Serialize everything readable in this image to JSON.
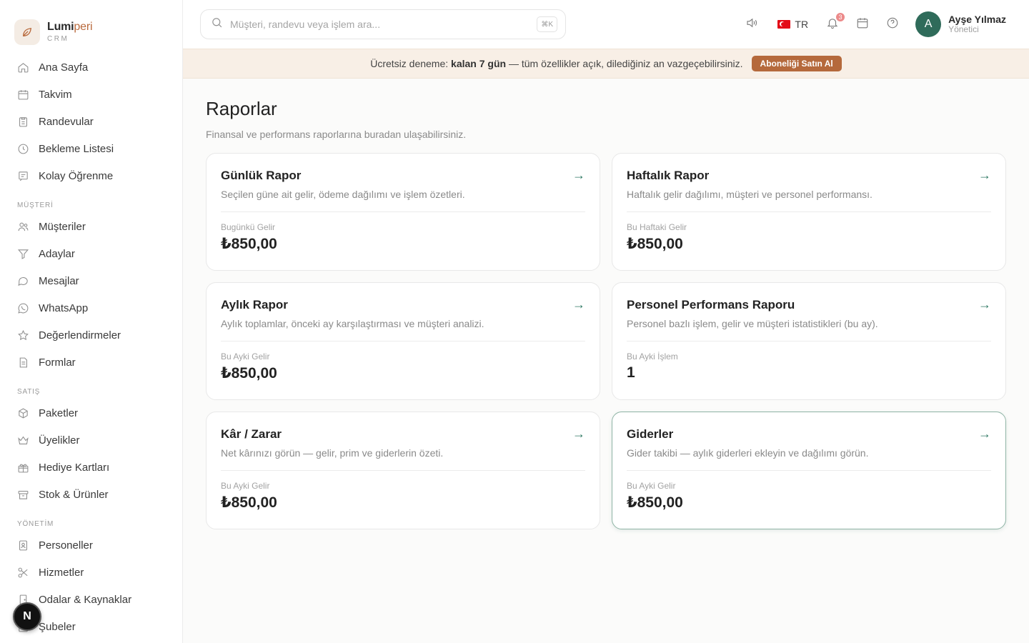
{
  "brand": {
    "name_main": "Lumi",
    "name_accent": "peri",
    "sub": "CRM"
  },
  "sidebar": {
    "top_items": [
      {
        "label": "Ana Sayfa",
        "icon": "home-icon"
      },
      {
        "label": "Takvim",
        "icon": "calendar-icon"
      },
      {
        "label": "Randevular",
        "icon": "clipboard-icon"
      },
      {
        "label": "Bekleme Listesi",
        "icon": "clock-icon"
      },
      {
        "label": "Kolay Öğrenme",
        "icon": "message-square-icon"
      }
    ],
    "section_musteri": "MÜŞTERİ",
    "musteri_items": [
      {
        "label": "Müşteriler",
        "icon": "users-icon"
      },
      {
        "label": "Adaylar",
        "icon": "funnel-icon"
      },
      {
        "label": "Mesajlar",
        "icon": "chat-icon"
      },
      {
        "label": "WhatsApp",
        "icon": "whatsapp-icon"
      },
      {
        "label": "Değerlendirmeler",
        "icon": "star-icon"
      },
      {
        "label": "Formlar",
        "icon": "document-icon"
      }
    ],
    "section_satis": "SATIŞ",
    "satis_items": [
      {
        "label": "Paketler",
        "icon": "package-icon"
      },
      {
        "label": "Üyelikler",
        "icon": "crown-icon"
      },
      {
        "label": "Hediye Kartları",
        "icon": "gift-icon"
      },
      {
        "label": "Stok & Ürünler",
        "icon": "archive-icon"
      }
    ],
    "section_yonetim": "YÖNETİM",
    "yonetim_items": [
      {
        "label": "Personeller",
        "icon": "badge-icon"
      },
      {
        "label": "Hizmetler",
        "icon": "scissors-icon"
      },
      {
        "label": "Odalar & Kaynaklar",
        "icon": "door-icon"
      },
      {
        "label": "Şubeler",
        "icon": "building-icon"
      }
    ],
    "fab_label": "N"
  },
  "topbar": {
    "search_placeholder": "Müşteri, randevu veya işlem ara...",
    "search_shortcut": "⌘K",
    "lang": "TR",
    "notification_count": "3",
    "user_initial": "A",
    "user_name": "Ayşe Yılmaz",
    "user_role": "Yönetici"
  },
  "banner": {
    "prefix": "Ücretsiz deneme: ",
    "highlight": "kalan 7 gün",
    "suffix": " — tüm özellikler açık, dilediğiniz an vazgeçebilirsiniz.",
    "button": "Aboneliği Satın Al"
  },
  "page": {
    "title": "Raporlar",
    "subtitle": "Finansal ve performans raporlarına buradan ulaşabilirsiniz."
  },
  "cards": [
    {
      "title": "Günlük Rapor",
      "desc": "Seçilen güne ait gelir, ödeme dağılımı ve işlem özetleri.",
      "label": "Bugünkü Gelir",
      "value": "₺850,00"
    },
    {
      "title": "Haftalık Rapor",
      "desc": "Haftalık gelir dağılımı, müşteri ve personel performansı.",
      "label": "Bu Haftaki Gelir",
      "value": "₺850,00"
    },
    {
      "title": "Aylık Rapor",
      "desc": "Aylık toplamlar, önceki ay karşılaştırması ve müşteri analizi.",
      "label": "Bu Ayki Gelir",
      "value": "₺850,00"
    },
    {
      "title": "Personel Performans Raporu",
      "desc": "Personel bazlı işlem, gelir ve müşteri istatistikleri (bu ay).",
      "label": "Bu Ayki İşlem",
      "value": "1"
    },
    {
      "title": "Kâr / Zarar",
      "desc": "Net kârınızı görün — gelir, prim ve giderlerin özeti.",
      "label": "Bu Ayki Gelir",
      "value": "₺850,00"
    },
    {
      "title": "Giderler",
      "desc": "Gider takibi — aylık giderleri ekleyin ve dağılımı görün.",
      "label": "Bu Ayki Gelir",
      "value": "₺850,00"
    }
  ],
  "card_arrow": "→",
  "colors": {
    "accent": "#b5693c",
    "brand_green": "#2f6b5a",
    "banner_bg": "#f8efe6"
  }
}
